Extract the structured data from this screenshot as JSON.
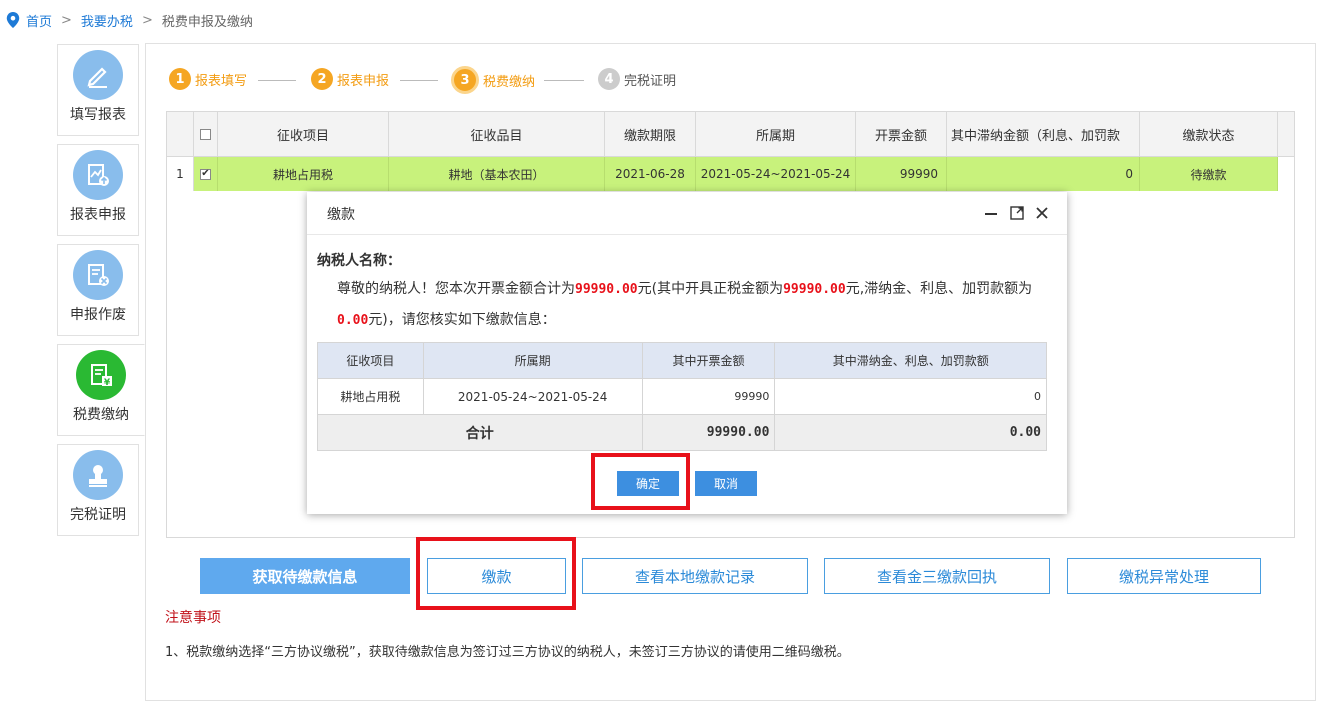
{
  "breadcrumb": {
    "home": "首页",
    "sep1": ">",
    "level1": "我要办税",
    "sep2": ">",
    "current": "税费申报及缴纳"
  },
  "sidebar": {
    "items": [
      {
        "label": "填写报表",
        "icon": "edit-icon"
      },
      {
        "label": "报表申报",
        "icon": "report-upload-icon"
      },
      {
        "label": "申报作废",
        "icon": "invalidate-icon"
      },
      {
        "label": "税费缴纳",
        "icon": "tax-payment-icon",
        "active": true
      },
      {
        "label": "完税证明",
        "icon": "certificate-stamp-icon"
      }
    ]
  },
  "steps": [
    {
      "num": "1",
      "label": "报表填写"
    },
    {
      "num": "2",
      "label": "报表申报"
    },
    {
      "num": "3",
      "label": "税费缴纳"
    },
    {
      "num": "4",
      "label": "完税证明"
    }
  ],
  "grid": {
    "columns": [
      "征收项目",
      "征收品目",
      "缴款期限",
      "所属期",
      "开票金额",
      "其中滞纳金额（利息、加罚款",
      "缴款状态"
    ],
    "rows": [
      {
        "rownum": "1",
        "checked": "✔",
        "item": "耕地占用税",
        "sub_item": "耕地（基本农田）",
        "deadline": "2021-06-28",
        "period": "2021-05-24~2021-05-24",
        "amount": "99990",
        "late_fee": "0",
        "status": "待缴款"
      }
    ]
  },
  "modal": {
    "title": "缴款",
    "taxpayer_label": "纳税人名称：",
    "msg_p1": "尊敬的纳税人！您本次开票金额合计为",
    "msg_total": "99990.00",
    "msg_p2": "元(其中开具正税金额为",
    "msg_tax": "99990.00",
    "msg_p3": "元,滞纳金、利息、加罚款额为",
    "msg_late": "0.00",
    "msg_p4": "元)，请您核实如下缴款信息：",
    "table": {
      "headers": [
        "征收项目",
        "所属期",
        "其中开票金额",
        "其中滞纳金、利息、加罚款额"
      ],
      "row": {
        "item": "耕地占用税",
        "period": "2021-05-24~2021-05-24",
        "amount": "99990",
        "late": "0"
      },
      "sum": {
        "label": "合计",
        "amount": "99990.00",
        "late": "0.00"
      }
    },
    "confirm": "确定",
    "cancel": "取消"
  },
  "buttons": {
    "fetch": "获取待缴款信息",
    "pay": "缴款",
    "local_records": "查看本地缴款记录",
    "jinsan_receipt": "查看金三缴款回执",
    "exception": "缴税异常处理"
  },
  "notes": {
    "title": "注意事项",
    "line1": "1、税款缴纳选择“三方协议缴税”，获取待缴款信息为签订过三方协议的纳税人，未签订三方协议的请使用二维码缴税。"
  },
  "colors": {
    "accent_blue": "#1e7ad6",
    "step_orange": "#f5a623",
    "row_highlight": "#c8f27c",
    "active_green": "#2ab933",
    "annotation_red": "#e8111a"
  }
}
